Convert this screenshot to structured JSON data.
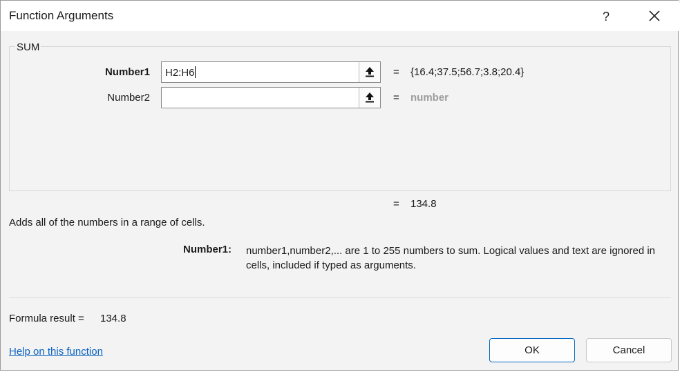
{
  "dialog": {
    "title": "Function Arguments",
    "help_glyph": "?",
    "close_glyph": "✕"
  },
  "function": {
    "name": "SUM",
    "arguments": [
      {
        "label": "Number1",
        "value": "H2:H6",
        "evaluated": "{16.4;37.5;56.7;3.8;20.4}"
      },
      {
        "label": "Number2",
        "value": "",
        "evaluated": "number"
      }
    ],
    "equals": "=",
    "result_value": "134.8",
    "description": "Adds all of the numbers in a range of cells.",
    "arg_help_label": "Number1:",
    "arg_help_text": "number1,number2,... are 1 to 255 numbers to sum. Logical values and text are ignored in cells, included if typed as arguments."
  },
  "footer": {
    "formula_result_label": "Formula result =",
    "formula_result_value": "134.8",
    "help_link": "Help on this function",
    "ok_label": "OK",
    "cancel_label": "Cancel"
  },
  "icons": {
    "collapse": "collapse-dialog-icon"
  }
}
